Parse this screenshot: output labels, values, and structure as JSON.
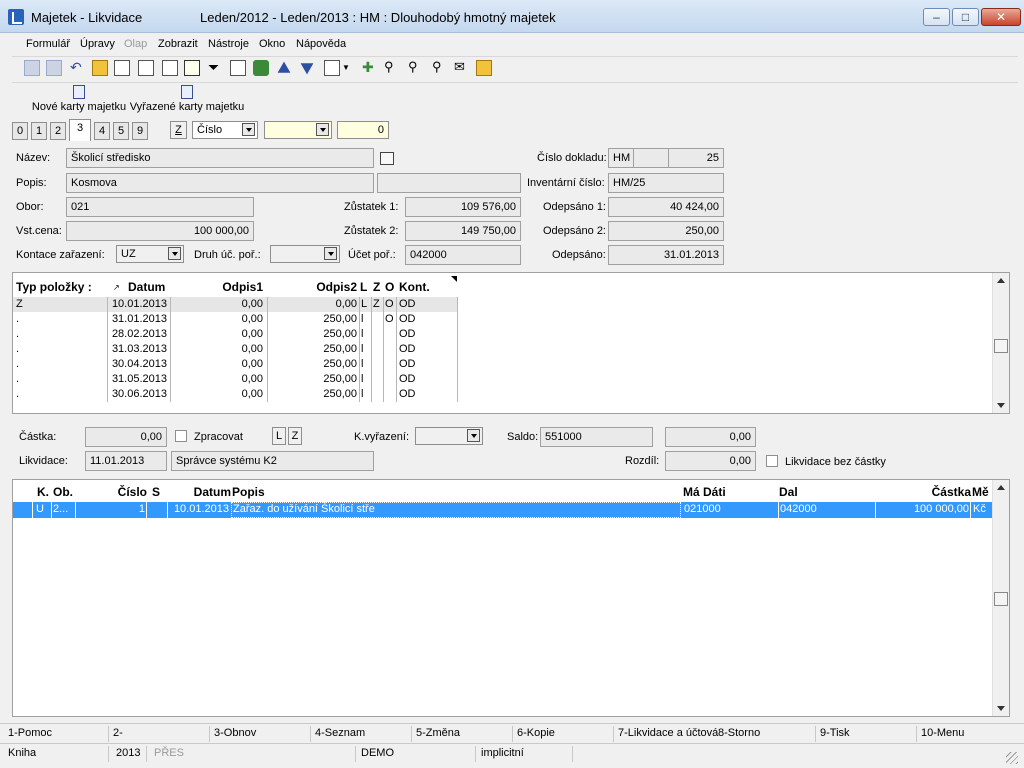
{
  "window": {
    "title": "Majetek - Likvidace",
    "period_title": "Leden/2012 - Leden/2013 : HM : Dlouhodobý hmotný majetek"
  },
  "menu": [
    {
      "label": "Formulář",
      "enabled": true
    },
    {
      "label": "Úpravy",
      "enabled": true
    },
    {
      "label": "Olap",
      "enabled": false
    },
    {
      "label": "Zobrazit",
      "enabled": true
    },
    {
      "label": "Nástroje",
      "enabled": true
    },
    {
      "label": "Okno",
      "enabled": true
    },
    {
      "label": "Nápověda",
      "enabled": true
    }
  ],
  "bigbuttons": [
    {
      "label": "Nové karty majetku"
    },
    {
      "label": "Vyřazené karty majetku"
    }
  ],
  "tabs": [
    "0",
    "1",
    "2",
    "3",
    "4",
    "5",
    "9"
  ],
  "active_tab": "3",
  "sort": {
    "z_label": "Z",
    "field": "Číslo",
    "value": "0"
  },
  "form": {
    "nazev_label": "Název:",
    "nazev": "Školicí středisko",
    "popis_label": "Popis:",
    "popis": "Kosmova",
    "obor_label": "Obor:",
    "obor": "021",
    "vstcena_label": "Vst.cena:",
    "vstcena": "100 000,00",
    "kontace_label": "Kontace zařazení:",
    "kontace": "UZ",
    "druh_label": "Druh úč. poř.:",
    "druh": "",
    "cislo_dokladu_label": "Číslo dokladu:",
    "cislo_dokladu_rada": "HM",
    "cislo_dokladu": "25",
    "inv_cislo_label": "Inventární číslo:",
    "inv_cislo": "HM/25",
    "zustatek1_label": "Zůstatek 1:",
    "zustatek1": "109 576,00",
    "zustatek2_label": "Zůstatek 2:",
    "zustatek2": "149 750,00",
    "ucet_label": "Účet poř.:",
    "ucet": "042000",
    "odepsano1_label": "Odepsáno 1:",
    "odepsano1": "40 424,00",
    "odepsano2_label": "Odepsáno 2:",
    "odepsano2": "250,00",
    "odepsano_label": "Odepsáno:",
    "odepsano": "31.01.2013"
  },
  "odpisy": {
    "headers": [
      "Typ položky :",
      "Datum",
      "Odpis1",
      "Odpis2",
      "L",
      "Z",
      "O",
      "Kont."
    ],
    "rows": [
      [
        "Z",
        "10.01.2013",
        "0,00",
        "0,00",
        "L",
        "Z",
        "O",
        "OD"
      ],
      [
        ".",
        "31.01.2013",
        "0,00",
        "250,00",
        "l",
        "",
        "O",
        "OD"
      ],
      [
        ".",
        "28.02.2013",
        "0,00",
        "250,00",
        "l",
        "",
        "",
        "OD"
      ],
      [
        ".",
        "31.03.2013",
        "0,00",
        "250,00",
        "l",
        "",
        "",
        "OD"
      ],
      [
        ".",
        "30.04.2013",
        "0,00",
        "250,00",
        "l",
        "",
        "",
        "OD"
      ],
      [
        ".",
        "31.05.2013",
        "0,00",
        "250,00",
        "l",
        "",
        "",
        "OD"
      ],
      [
        ".",
        "30.06.2013",
        "0,00",
        "250,00",
        "l",
        "",
        "",
        "OD"
      ]
    ]
  },
  "likvidace": {
    "castka_label": "Částka:",
    "castka": "0,00",
    "zpracovat_label": "Zpracovat",
    "l_label": "L",
    "z_label": "Z",
    "kvyrazeni_label": "K.vyřazení:",
    "kvyrazeni": "",
    "saldo_label": "Saldo:",
    "saldo": "551000",
    "saldo_value": "0,00",
    "likvidace_label": "Likvidace:",
    "likvidace_date": "11.01.2013",
    "likvidace_user": "Správce systému K2",
    "rozdil_label": "Rozdíl:",
    "rozdil": "0,00",
    "bez_castky_label": "Likvidace bez částky"
  },
  "lines": {
    "headers": [
      "K.",
      "Ob.",
      "Číslo",
      "S",
      "Datum",
      "Popis",
      "Má Dáti",
      "Dal",
      "Částka",
      "Mě"
    ],
    "rows": [
      [
        "U",
        "2...",
        "1",
        "",
        "10.01.2013",
        "Zařaz. do užívání Školicí stře",
        "021000",
        "042000",
        "100 000,00",
        "Kč"
      ]
    ]
  },
  "fkeys": [
    "1-Pomoc",
    "2-",
    "3-Obnov",
    "4-Seznam",
    "5-Změna",
    "6-Kopie",
    "7-Likvidace a účtová",
    "8-Storno",
    "9-Tisk",
    "10-Menu"
  ],
  "status": {
    "kniha": "Kniha",
    "year": "2013",
    "pres": "PŘES",
    "demo": "DEMO",
    "implicitni": "implicitní"
  }
}
